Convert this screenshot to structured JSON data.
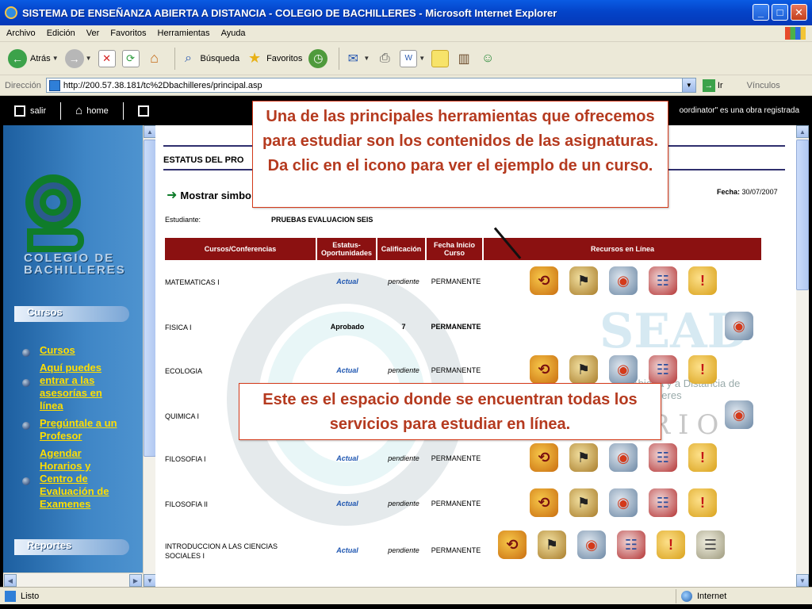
{
  "window": {
    "title": "SISTEMA DE ENSEÑANZA ABIERTA A DISTANCIA - COLEGIO DE BACHILLERES - Microsoft Internet Explorer",
    "minimize": "_",
    "maximize": "□",
    "close": "✕"
  },
  "menu": [
    "Archivo",
    "Edición",
    "Ver",
    "Favoritos",
    "Herramientas",
    "Ayuda"
  ],
  "toolbar": {
    "back_label": "Atrás",
    "search_label": "Búsqueda",
    "favorites_label": "Favoritos"
  },
  "address": {
    "label": "Dirección",
    "url": "http://200.57.38.181/tc%2Dbachilleres/principal.asp",
    "go_label": "Ir",
    "links_label": "Vínculos"
  },
  "sitenav": {
    "salir": "salir",
    "home": "home",
    "copyright": "oordinator\" es una obra registrada"
  },
  "sidebar": {
    "logo_text_1": "COLEGIO DE",
    "logo_text_2": "BACHILLERES",
    "cursos_header": "Cursos",
    "links": [
      "Cursos",
      "Aquí puedes entrar a las asesorías en línea",
      "Pregúntale a un Profesor",
      "Agendar Horarios y Centro de Evaluación de Examenes"
    ],
    "reportes_header": "Reportes"
  },
  "main": {
    "title": "ESTATUS DEL PRO",
    "mostrar": "Mostrar simbo",
    "fecha_label": "Fecha:",
    "fecha_value": "30/07/2007",
    "estudiante_label": "Estudiante:",
    "estudiante_value": "PRUEBAS EVALUACION SEIS",
    "headers": [
      "Cursos/Conferencias",
      "Estatus-Oportunidades",
      "Calificación",
      "Fecha Inicio Curso",
      "Recursos en Línea"
    ],
    "rows": [
      {
        "curso": "MATEMATICAS I",
        "estatus": "Actual",
        "calif": "pendiente",
        "fecha": "PERMANENTE"
      },
      {
        "curso": "FISICA I",
        "estatus": "Aprobado",
        "calif": "7",
        "fecha": "PERMANENTE"
      },
      {
        "curso": "ECOLOGIA",
        "estatus": "Actual",
        "calif": "pendiente",
        "fecha": "PERMANENTE"
      },
      {
        "curso": "QUIMICA I",
        "estatus": "",
        "calif": "",
        "fecha": ""
      },
      {
        "curso": "FILOSOFIA I",
        "estatus": "Actual",
        "calif": "pendiente",
        "fecha": "PERMANENTE"
      },
      {
        "curso": "FILOSOFIA II",
        "estatus": "Actual",
        "calif": "pendiente",
        "fecha": "PERMANENTE"
      },
      {
        "curso": "INTRODUCCION A LAS CIENCIAS SOCIALES I",
        "estatus": "Actual",
        "calif": "pendiente",
        "fecha": "PERMANENTE"
      }
    ],
    "bg_text_1": "SEAD",
    "bg_text_2": "RSARIO",
    "bg_text_3": "Abierta y a Distancia de Bachilleres"
  },
  "callouts": {
    "top": "Una de las principales herramientas que ofrecemos para estudiar son los contenidos de las asignaturas. Da clic en el icono para ver el ejemplo de un curso.",
    "bottom": "Este es el espacio donde se encuentran todas los servicios para estudiar en línea."
  },
  "status": {
    "left": "Listo",
    "zone": "Internet"
  }
}
